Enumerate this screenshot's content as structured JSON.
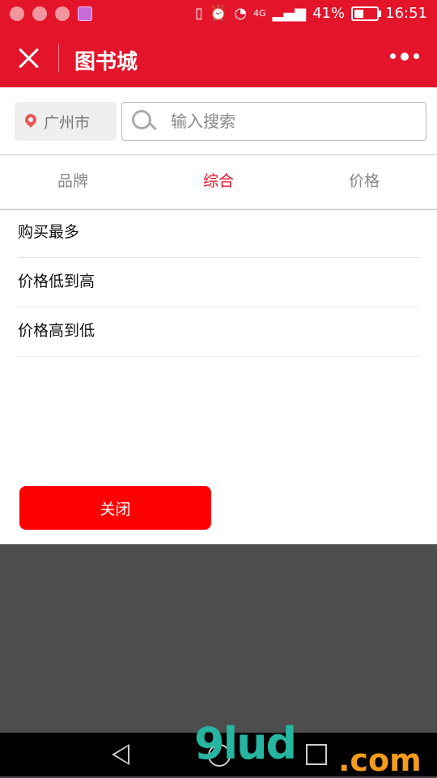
{
  "status_bar": {
    "battery": "41%",
    "network": "4G",
    "time": "16:51",
    "battery_level": 0.41
  },
  "app_bar": {
    "title": "图书城"
  },
  "filter": {
    "city": "广州市",
    "search_placeholder": "输入搜索"
  },
  "tabs": [
    {
      "label": "品牌",
      "active": false
    },
    {
      "label": "综合",
      "active": true
    },
    {
      "label": "价格",
      "active": false
    }
  ],
  "sort_options": [
    "购买最多",
    "价格低到高",
    "价格高到低"
  ],
  "close_label": "关闭",
  "watermark": {
    "text": "9lud",
    "suffix": ".com"
  },
  "colors": {
    "brand_red": "#e4142b",
    "button_red": "#ff0000",
    "overlay": "#4d4d4d"
  }
}
